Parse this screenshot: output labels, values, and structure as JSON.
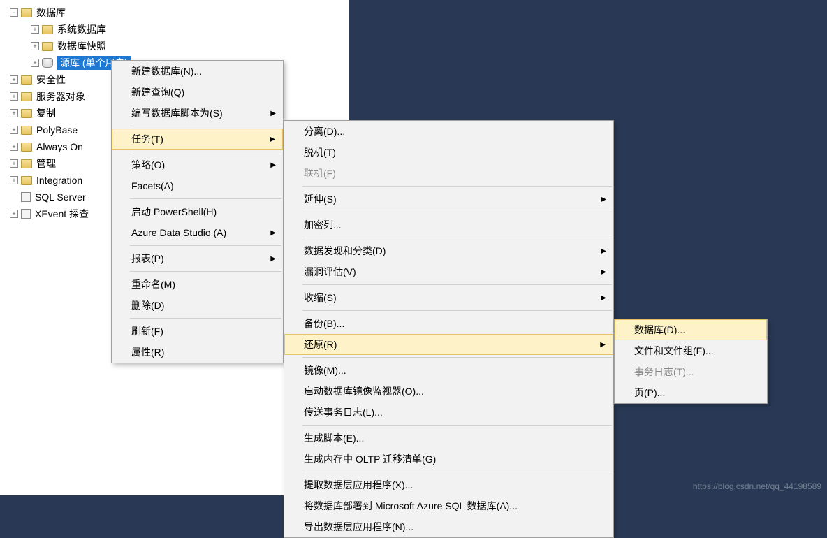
{
  "tree": {
    "root": "数据库",
    "items": [
      {
        "level": 2,
        "expander": "+",
        "icon": "folder",
        "label": "系统数据库"
      },
      {
        "level": 2,
        "expander": "+",
        "icon": "folder",
        "label": "数据库快照"
      },
      {
        "level": 3,
        "expander": "+",
        "icon": "db",
        "label": "源库 (单个用户)",
        "selected": true
      },
      {
        "level": 1,
        "expander": "+",
        "icon": "folder",
        "label": "安全性"
      },
      {
        "level": 1,
        "expander": "+",
        "icon": "folder",
        "label": "服务器对象"
      },
      {
        "level": 1,
        "expander": "+",
        "icon": "folder",
        "label": "复制"
      },
      {
        "level": 1,
        "expander": "+",
        "icon": "folder",
        "label": "PolyBase"
      },
      {
        "level": 1,
        "expander": "+",
        "icon": "folder",
        "label": "Always On"
      },
      {
        "level": 1,
        "expander": "+",
        "icon": "folder",
        "label": "管理"
      },
      {
        "level": 1,
        "expander": "+",
        "icon": "folder",
        "label": "Integration"
      },
      {
        "level": 1,
        "expander": "",
        "icon": "other",
        "label": "SQL Server"
      },
      {
        "level": 1,
        "expander": "+",
        "icon": "other",
        "label": "XEvent 探查"
      }
    ]
  },
  "menu1": {
    "items": [
      {
        "label": "新建数据库(N)..."
      },
      {
        "label": "新建查询(Q)"
      },
      {
        "label": "编写数据库脚本为(S)",
        "submenu": true
      },
      {
        "sep": true
      },
      {
        "label": "任务(T)",
        "submenu": true,
        "highlighted": true
      },
      {
        "sep": true
      },
      {
        "label": "策略(O)",
        "submenu": true
      },
      {
        "label": "Facets(A)"
      },
      {
        "sep": true
      },
      {
        "label": "启动 PowerShell(H)"
      },
      {
        "label": "Azure Data Studio (A)",
        "submenu": true
      },
      {
        "sep": true
      },
      {
        "label": "报表(P)",
        "submenu": true
      },
      {
        "sep": true
      },
      {
        "label": "重命名(M)"
      },
      {
        "label": "删除(D)"
      },
      {
        "sep": true
      },
      {
        "label": "刷新(F)"
      },
      {
        "label": "属性(R)"
      }
    ]
  },
  "menu2": {
    "items": [
      {
        "label": "分离(D)..."
      },
      {
        "label": "脱机(T)"
      },
      {
        "label": "联机(F)",
        "disabled": true
      },
      {
        "sep": true
      },
      {
        "label": "延伸(S)",
        "submenu": true
      },
      {
        "sep": true
      },
      {
        "label": "加密列..."
      },
      {
        "sep": true
      },
      {
        "label": "数据发现和分类(D)",
        "submenu": true
      },
      {
        "label": "漏洞评估(V)",
        "submenu": true
      },
      {
        "sep": true
      },
      {
        "label": "收缩(S)",
        "submenu": true
      },
      {
        "sep": true
      },
      {
        "label": "备份(B)..."
      },
      {
        "label": "还原(R)",
        "submenu": true,
        "highlighted": true
      },
      {
        "sep": true
      },
      {
        "label": "镜像(M)..."
      },
      {
        "label": "启动数据库镜像监视器(O)..."
      },
      {
        "label": "传送事务日志(L)..."
      },
      {
        "sep": true
      },
      {
        "label": "生成脚本(E)..."
      },
      {
        "label": "生成内存中 OLTP 迁移清单(G)"
      },
      {
        "sep": true
      },
      {
        "label": "提取数据层应用程序(X)..."
      },
      {
        "label": "将数据库部署到 Microsoft Azure SQL 数据库(A)..."
      },
      {
        "label": "导出数据层应用程序(N)..."
      }
    ]
  },
  "menu3": {
    "items": [
      {
        "label": "数据库(D)...",
        "highlighted": true
      },
      {
        "label": "文件和文件组(F)..."
      },
      {
        "label": "事务日志(T)...",
        "disabled": true
      },
      {
        "label": "页(P)..."
      }
    ]
  },
  "watermark": "https://blog.csdn.net/qq_44198589"
}
